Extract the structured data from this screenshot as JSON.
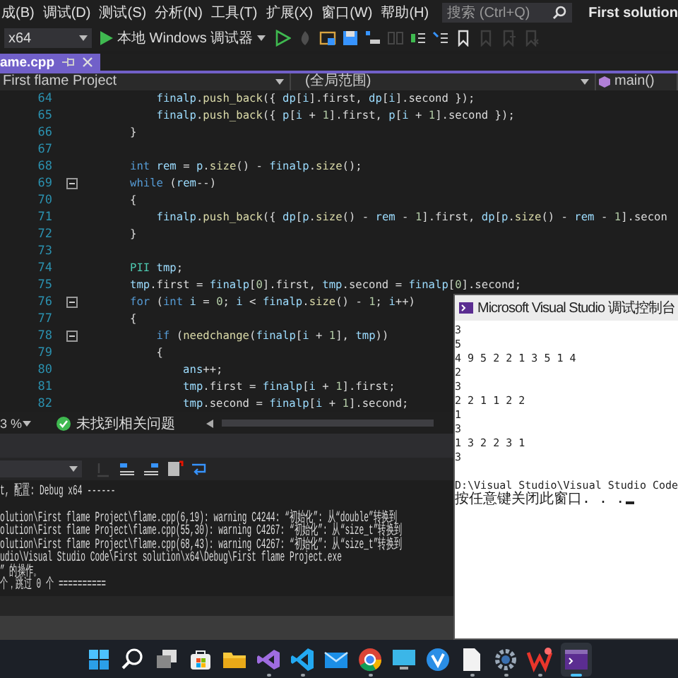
{
  "menu": [
    {
      "label": "成(B)"
    },
    {
      "label": "调试(D)"
    },
    {
      "label": "测试(S)"
    },
    {
      "label": "分析(N)"
    },
    {
      "label": "工具(T)"
    },
    {
      "label": "扩展(X)"
    },
    {
      "label": "窗口(W)"
    },
    {
      "label": "帮助(H)"
    }
  ],
  "search": {
    "placeholder": "搜索 (Ctrl+Q)"
  },
  "solution_name": "First solution",
  "toolbar": {
    "platform": "x64",
    "debugger": "本地 Windows 调试器",
    "icons": [
      {
        "kind": "play-outline",
        "disabled": false
      },
      {
        "kind": "flame",
        "disabled": true
      },
      {
        "kind": "window",
        "disabled": false
      },
      {
        "kind": "save",
        "disabled": false
      },
      {
        "kind": "step",
        "disabled": false
      },
      {
        "kind": "columns",
        "disabled": true
      },
      {
        "kind": "comment",
        "disabled": false
      },
      {
        "kind": "uncomment",
        "disabled": false
      },
      {
        "kind": "bookmark",
        "disabled": false
      },
      {
        "kind": "bookmark-prev",
        "disabled": true
      },
      {
        "kind": "bookmark-next",
        "disabled": true
      },
      {
        "kind": "bookmark-clear",
        "disabled": true
      }
    ]
  },
  "tabs": [
    {
      "label": "ame.cpp",
      "selected": true
    }
  ],
  "nav": {
    "project": "First flame Project",
    "scope": "(全局范围)",
    "member": "main()"
  },
  "code_lines": [
    {
      "number": "64",
      "fold": false,
      "tokens": [
        {
          "kind": "var",
          "text": "    finalp"
        },
        {
          "kind": "text",
          "text": "."
        },
        {
          "kind": "fn",
          "text": "push_back"
        },
        {
          "kind": "text",
          "text": "({ "
        },
        {
          "kind": "var",
          "text": "dp"
        },
        {
          "kind": "text",
          "text": "["
        },
        {
          "kind": "var",
          "text": "i"
        },
        {
          "kind": "text",
          "text": "].first, "
        },
        {
          "kind": "var",
          "text": "dp"
        },
        {
          "kind": "text",
          "text": "["
        },
        {
          "kind": "var",
          "text": "i"
        },
        {
          "kind": "text",
          "text": "].second });"
        }
      ]
    },
    {
      "number": "65",
      "fold": false,
      "tokens": [
        {
          "kind": "var",
          "text": "    finalp"
        },
        {
          "kind": "text",
          "text": "."
        },
        {
          "kind": "fn",
          "text": "push_back"
        },
        {
          "kind": "text",
          "text": "({ "
        },
        {
          "kind": "var",
          "text": "p"
        },
        {
          "kind": "text",
          "text": "["
        },
        {
          "kind": "var",
          "text": "i"
        },
        {
          "kind": "text",
          "text": " + "
        },
        {
          "kind": "num",
          "text": "1"
        },
        {
          "kind": "text",
          "text": "].first, "
        },
        {
          "kind": "var",
          "text": "p"
        },
        {
          "kind": "text",
          "text": "["
        },
        {
          "kind": "var",
          "text": "i"
        },
        {
          "kind": "text",
          "text": " + "
        },
        {
          "kind": "num",
          "text": "1"
        },
        {
          "kind": "text",
          "text": "].second });"
        }
      ]
    },
    {
      "number": "66",
      "fold": false,
      "tokens": [
        {
          "kind": "text",
          "text": "}"
        }
      ]
    },
    {
      "number": "67",
      "fold": false
    },
    {
      "number": "68",
      "fold": false,
      "tokens": [
        {
          "kind": "kw",
          "text": "int"
        },
        {
          "kind": "var",
          "text": " rem"
        },
        {
          "kind": "text",
          "text": " = "
        },
        {
          "kind": "var",
          "text": "p"
        },
        {
          "kind": "text",
          "text": "."
        },
        {
          "kind": "fn",
          "text": "size"
        },
        {
          "kind": "text",
          "text": "() - "
        },
        {
          "kind": "var",
          "text": "finalp"
        },
        {
          "kind": "text",
          "text": "."
        },
        {
          "kind": "fn",
          "text": "size"
        },
        {
          "kind": "text",
          "text": "();"
        }
      ]
    },
    {
      "number": "69",
      "fold": true,
      "tokens": [
        {
          "kind": "kw",
          "text": "while"
        },
        {
          "kind": "text",
          "text": " ("
        },
        {
          "kind": "var",
          "text": "rem"
        },
        {
          "kind": "text",
          "text": "--)"
        }
      ]
    },
    {
      "number": "70",
      "fold": false,
      "tokens": [
        {
          "kind": "text",
          "text": "{"
        }
      ]
    },
    {
      "number": "71",
      "fold": false,
      "tokens": [
        {
          "kind": "var",
          "text": "    finalp"
        },
        {
          "kind": "text",
          "text": "."
        },
        {
          "kind": "fn",
          "text": "push_back"
        },
        {
          "kind": "text",
          "text": "({ "
        },
        {
          "kind": "var",
          "text": "dp"
        },
        {
          "kind": "text",
          "text": "["
        },
        {
          "kind": "var",
          "text": "p"
        },
        {
          "kind": "text",
          "text": "."
        },
        {
          "kind": "fn",
          "text": "size"
        },
        {
          "kind": "text",
          "text": "() - "
        },
        {
          "kind": "var",
          "text": "rem"
        },
        {
          "kind": "text",
          "text": " - "
        },
        {
          "kind": "num",
          "text": "1"
        },
        {
          "kind": "text",
          "text": "].first, "
        },
        {
          "kind": "var",
          "text": "dp"
        },
        {
          "kind": "text",
          "text": "["
        },
        {
          "kind": "var",
          "text": "p"
        },
        {
          "kind": "text",
          "text": "."
        },
        {
          "kind": "fn",
          "text": "size"
        },
        {
          "kind": "text",
          "text": "() - "
        },
        {
          "kind": "var",
          "text": "rem"
        },
        {
          "kind": "text",
          "text": " - "
        },
        {
          "kind": "num",
          "text": "1"
        },
        {
          "kind": "text",
          "text": "].secon"
        }
      ]
    },
    {
      "number": "72",
      "fold": false,
      "tokens": [
        {
          "kind": "text",
          "text": "}"
        }
      ]
    },
    {
      "number": "73",
      "fold": false
    },
    {
      "number": "74",
      "fold": false,
      "tokens": [
        {
          "kind": "type",
          "text": "PII"
        },
        {
          "kind": "var",
          "text": " tmp"
        },
        {
          "kind": "text",
          "text": ";"
        }
      ]
    },
    {
      "number": "75",
      "fold": false,
      "tokens": [
        {
          "kind": "var",
          "text": "tmp"
        },
        {
          "kind": "text",
          "text": ".first = "
        },
        {
          "kind": "var",
          "text": "finalp"
        },
        {
          "kind": "text",
          "text": "["
        },
        {
          "kind": "num",
          "text": "0"
        },
        {
          "kind": "text",
          "text": "].first, "
        },
        {
          "kind": "var",
          "text": "tmp"
        },
        {
          "kind": "text",
          "text": ".second = "
        },
        {
          "kind": "var",
          "text": "finalp"
        },
        {
          "kind": "text",
          "text": "["
        },
        {
          "kind": "num",
          "text": "0"
        },
        {
          "kind": "text",
          "text": "].second;"
        }
      ]
    },
    {
      "number": "76",
      "fold": true,
      "tokens": [
        {
          "kind": "kw",
          "text": "for"
        },
        {
          "kind": "text",
          "text": " ("
        },
        {
          "kind": "kw",
          "text": "int"
        },
        {
          "kind": "var",
          "text": " i"
        },
        {
          "kind": "text",
          "text": " = "
        },
        {
          "kind": "num",
          "text": "0"
        },
        {
          "kind": "text",
          "text": "; "
        },
        {
          "kind": "var",
          "text": "i"
        },
        {
          "kind": "text",
          "text": " < "
        },
        {
          "kind": "var",
          "text": "finalp"
        },
        {
          "kind": "text",
          "text": "."
        },
        {
          "kind": "fn",
          "text": "size"
        },
        {
          "kind": "text",
          "text": "() - "
        },
        {
          "kind": "num",
          "text": "1"
        },
        {
          "kind": "text",
          "text": "; "
        },
        {
          "kind": "var",
          "text": "i"
        },
        {
          "kind": "text",
          "text": "++)"
        }
      ]
    },
    {
      "number": "77",
      "fold": false,
      "tokens": [
        {
          "kind": "text",
          "text": "{"
        }
      ]
    },
    {
      "number": "78",
      "fold": true,
      "tokens": [
        {
          "kind": "kw",
          "text": "    if"
        },
        {
          "kind": "text",
          "text": " ("
        },
        {
          "kind": "fn",
          "text": "needchange"
        },
        {
          "kind": "text",
          "text": "("
        },
        {
          "kind": "var",
          "text": "finalp"
        },
        {
          "kind": "text",
          "text": "["
        },
        {
          "kind": "var",
          "text": "i"
        },
        {
          "kind": "text",
          "text": " + "
        },
        {
          "kind": "num",
          "text": "1"
        },
        {
          "kind": "text",
          "text": "], "
        },
        {
          "kind": "var",
          "text": "tmp"
        },
        {
          "kind": "text",
          "text": "))"
        }
      ]
    },
    {
      "number": "79",
      "fold": false,
      "tokens": [
        {
          "kind": "text",
          "text": "    {"
        }
      ]
    },
    {
      "number": "80",
      "fold": false,
      "tokens": [
        {
          "kind": "var",
          "text": "        ans"
        },
        {
          "kind": "text",
          "text": "++;"
        }
      ]
    },
    {
      "number": "81",
      "fold": false,
      "tokens": [
        {
          "kind": "var",
          "text": "        tmp"
        },
        {
          "kind": "text",
          "text": ".first = "
        },
        {
          "kind": "var",
          "text": "finalp"
        },
        {
          "kind": "text",
          "text": "["
        },
        {
          "kind": "var",
          "text": "i"
        },
        {
          "kind": "text",
          "text": " + "
        },
        {
          "kind": "num",
          "text": "1"
        },
        {
          "kind": "text",
          "text": "].first;"
        }
      ]
    },
    {
      "number": "82",
      "fold": false,
      "tokens": [
        {
          "kind": "var",
          "text": "        tmp"
        },
        {
          "kind": "text",
          "text": ".second = "
        },
        {
          "kind": "var",
          "text": "finalp"
        },
        {
          "kind": "text",
          "text": "["
        },
        {
          "kind": "var",
          "text": "i"
        },
        {
          "kind": "text",
          "text": " + "
        },
        {
          "kind": "num",
          "text": "1"
        },
        {
          "kind": "text",
          "text": "].second;"
        }
      ]
    }
  ],
  "status": {
    "zoom": "3 %",
    "issues": "未找到相关问题"
  },
  "output": {
    "header": "t, 配置: Debug x64 ------",
    "lines": [
      "olution\\First flame Project\\flame.cpp(6,19): warning C4244: “初始化”: 从“double”转换到",
      "olution\\First flame Project\\flame.cpp(55,30): warning C4267: “初始化”: 从“size_t”转换到",
      "olution\\First flame Project\\flame.cpp(68,43): warning C4267: “初始化”: 从“size_t”转换到",
      "udio\\Visual Studio Code\\First solution\\x64\\Debug\\First flame Project.exe",
      "” 的操作。",
      "个，跳过 0 个 =========="
    ]
  },
  "console": {
    "title": "Microsoft Visual Studio 调试控制台",
    "lines": [
      "3",
      "5",
      "4 9 5 2 2 1 3 5 1 4",
      "2",
      "3",
      "2 2 1 1 2 2",
      "1",
      "3",
      "1 3 2 2 3 1",
      "3"
    ],
    "path": "D:\\Visual Studio\\Visual Studio Code",
    "prompt": "按任意键关闭此窗口. . ."
  },
  "taskbar": [
    {
      "kind": "start",
      "running": false,
      "selected": false
    },
    {
      "kind": "search",
      "running": false,
      "selected": false
    },
    {
      "kind": "taskview",
      "running": false,
      "selected": false
    },
    {
      "kind": "store",
      "running": false,
      "selected": false
    },
    {
      "kind": "folder",
      "running": false,
      "selected": false
    },
    {
      "kind": "vs",
      "running": true,
      "selected": false
    },
    {
      "kind": "vscode",
      "running": true,
      "selected": false
    },
    {
      "kind": "mail",
      "running": false,
      "selected": false
    },
    {
      "kind": "browser",
      "running": true,
      "selected": false
    },
    {
      "kind": "monitor",
      "running": false,
      "selected": false
    },
    {
      "kind": "vcircle",
      "running": false,
      "selected": false
    },
    {
      "kind": "document",
      "running": true,
      "selected": false
    },
    {
      "kind": "gear",
      "running": true,
      "selected": false
    },
    {
      "kind": "wlogo",
      "running": true,
      "selected": false
    },
    {
      "kind": "console",
      "running": true,
      "selected": true
    }
  ]
}
